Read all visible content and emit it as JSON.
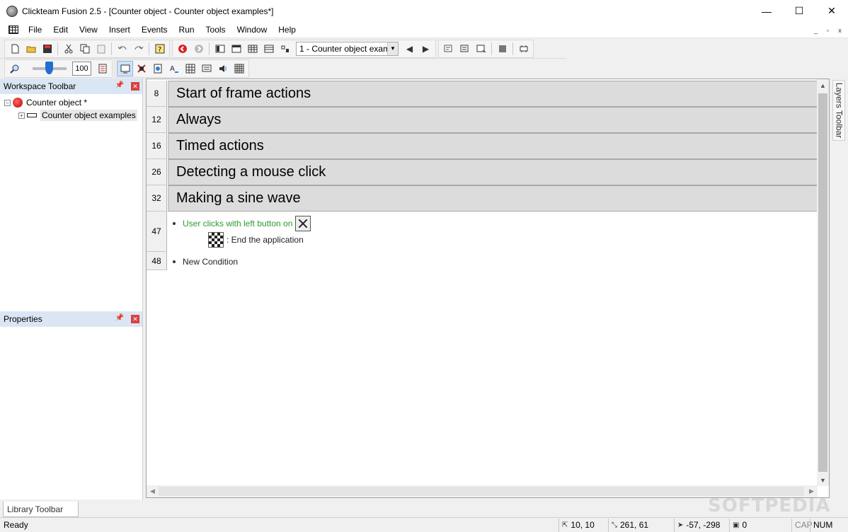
{
  "window": {
    "title": "Clickteam Fusion 2.5 - [Counter object - Counter object examples*]",
    "controls": [
      "—",
      "☐",
      "✕"
    ]
  },
  "menu": {
    "items": [
      "File",
      "Edit",
      "View",
      "Insert",
      "Events",
      "Run",
      "Tools",
      "Window",
      "Help"
    ],
    "mdi": [
      "_",
      "▫",
      "x"
    ]
  },
  "toolbar": {
    "frame_select": "1 - Counter object exam",
    "zoom": "100"
  },
  "workspace": {
    "title": "Workspace Toolbar",
    "tree": [
      {
        "label": "Counter object *"
      },
      {
        "label": "Counter object examples"
      }
    ]
  },
  "properties": {
    "title": "Properties"
  },
  "groups": [
    {
      "line": "8",
      "title": "Start of frame actions"
    },
    {
      "line": "12",
      "title": "Always"
    },
    {
      "line": "16",
      "title": "Timed actions"
    },
    {
      "line": "26",
      "title": "Detecting a mouse click"
    },
    {
      "line": "32",
      "title": "Making a sine wave"
    }
  ],
  "events": [
    {
      "line": "47",
      "condition": "User clicks with left button on",
      "action": ": End the application"
    },
    {
      "line": "48",
      "condition": "New Condition"
    }
  ],
  "layers_tab": "Layers Toolbar",
  "library_tab": "Library Toolbar",
  "status": {
    "ready": "Ready",
    "coord1": "10, 10",
    "coord2": "261, 61",
    "coord3": "-57, -298",
    "count": "0",
    "caps": "CAP",
    "num": "NUM"
  },
  "watermark": "SOFTPEDIA",
  "colors": {
    "condition_text": "#2e9a2e",
    "panel_header": "#dbe6f4",
    "group_bg": "#dcdcdc"
  }
}
